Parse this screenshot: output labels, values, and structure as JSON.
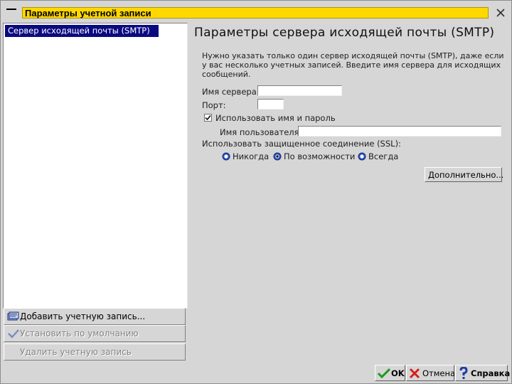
{
  "window": {
    "title": "Параметры учетной записи"
  },
  "accounts": {
    "items": [
      "Сервер исходящей почты (SMTP)"
    ],
    "add_label": "Добавить учетную запись...",
    "default_label": "Установить по умолчанию",
    "delete_label": "Удалить учетную запись"
  },
  "smtp": {
    "heading": "Параметры сервера исходящей почты (SMTP)",
    "description": "Нужно указать только один сервер исходящей почты (SMTP), даже если у вас несколько учетных записей. Введите имя сервера для исходящих сообщений.",
    "server_label": "Имя сервера:",
    "server_value": "",
    "port_label": "Порт:",
    "port_value": "",
    "use_auth_label": "Использовать имя и пароль",
    "use_auth_checked": true,
    "username_label": "Имя пользователя:",
    "username_value": "",
    "ssl_label": "Использовать защищенное соединение (SSL):",
    "ssl_options": [
      "Никогда",
      "По возможности",
      "Всегда"
    ],
    "ssl_selected": "По возможности",
    "advanced_label": "Дополнительно..."
  },
  "footer": {
    "ok_label": "OK",
    "cancel_label": "Отмена",
    "help_label": "Справка"
  },
  "colors": {
    "title_bg": "#ffd800",
    "selection_bg": "#0a0a80",
    "window_bg": "#d6d6d6"
  }
}
